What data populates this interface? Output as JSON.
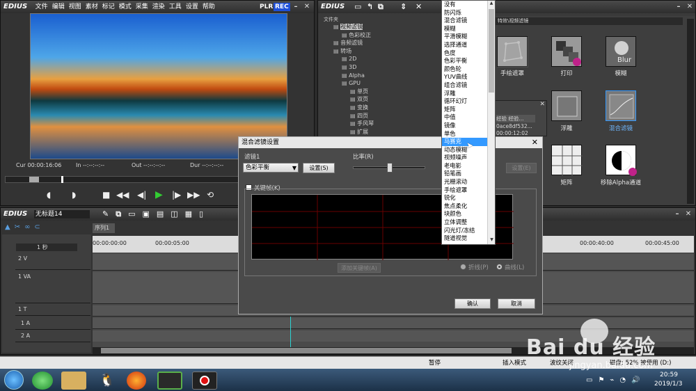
{
  "player": {
    "brand": "EDIUS",
    "menu": [
      "文件",
      "编辑",
      "视图",
      "素材",
      "标记",
      "模式",
      "采集",
      "渲染",
      "工具",
      "设置",
      "帮助"
    ],
    "plr": "PLR",
    "rec": "REC",
    "cur": "Cur 00:00:16:06",
    "in": "In --:--:--:--",
    "out": "Out --:--:--:--",
    "dur": "Dur --:--:--:--"
  },
  "library": {
    "brand": "EDIUS",
    "folder_header": "文件夹",
    "path": "特效\\视频滤镜",
    "tree": [
      {
        "label": "视频滤镜",
        "indent": 0
      },
      {
        "label": "色彩校正",
        "indent": 1
      },
      {
        "label": "音频滤镜",
        "indent": 0
      },
      {
        "label": "转场",
        "indent": 0
      },
      {
        "label": "2D",
        "indent": 1
      },
      {
        "label": "3D",
        "indent": 1
      },
      {
        "label": "Alpha",
        "indent": 1
      },
      {
        "label": "GPU",
        "indent": 1
      },
      {
        "label": "单页",
        "indent": 2
      },
      {
        "label": "双页",
        "indent": 2
      },
      {
        "label": "变换",
        "indent": 2
      },
      {
        "label": "四页",
        "indent": 2
      },
      {
        "label": "手风琴",
        "indent": 2
      },
      {
        "label": "扩展",
        "indent": 2
      }
    ],
    "effects": [
      {
        "label": "手绘遮罩"
      },
      {
        "label": "打印"
      },
      {
        "label": "模糊"
      },
      {
        "label": "浮雕"
      },
      {
        "label": "混合滤镜"
      },
      {
        "label": "矩阵"
      },
      {
        "label": "移除Alpha通道"
      }
    ],
    "blur_text": "Blur"
  },
  "info": {
    "line1": "经验 经验...",
    "line2": "0ace8df532...",
    "line3": "00:00:12:02"
  },
  "dropdown": {
    "items": [
      "没有",
      "防闪烁",
      "混合滤镜",
      "模糊",
      "平滑模糊",
      "选择通道",
      "色度",
      "色彩平衡",
      "颜色轮",
      "YUV曲线",
      "组合滤镜",
      "浮雕",
      "循环幻灯",
      "矩阵",
      "中值",
      "镜像",
      "单色",
      "马赛克",
      "动态模糊",
      "视频噪声",
      "老电影",
      "铅笔画",
      "光栅滚动",
      "手绘遮罩",
      "锐化",
      "焦点柔化",
      "块颜色",
      "立体调整",
      "闪光灯/冻结",
      "隧道视觉"
    ],
    "selected_index": 17
  },
  "dialog": {
    "title": "混合滤镜设置",
    "filter_label": "滤镜1",
    "filter_value": "色彩平衡",
    "settings_btn": "设置(S)",
    "ratio_label": "比率(R)",
    "ratio_value": 0.5,
    "settings_btn2": "设置(E)",
    "keyframe_label": "关键帧(K)",
    "add_keyframe": "添加关键帧(A)",
    "polyline": "折线(P)",
    "curve": "曲线(L)",
    "ok": "确认",
    "cancel": "取消"
  },
  "timeline": {
    "brand": "EDIUS",
    "project": "无标题14",
    "sequence_tab": "序列1",
    "scale": "1 秒",
    "ticks": [
      "00:00:00:00",
      "00:00:05:00",
      "00:00:40:00",
      "00:00:45:00"
    ],
    "tracks": [
      "2 V",
      "1 VA",
      "1 T",
      "1 A",
      "2 A"
    ]
  },
  "status": {
    "pause": "暂停",
    "insert_mode": "插入模式",
    "ripple_off": "波纹关闭",
    "disk": "磁盘: 52% 被使用 (D:)"
  },
  "taskbar": {
    "time": "20:59",
    "date": "2019/1/3"
  },
  "watermark": {
    "brand": "Bai du 经验",
    "url": "jingyan.baidu.com"
  },
  "colors": {
    "selection": "#3399ff",
    "rec": "#1e4fd8",
    "play_green": "#33cc33"
  }
}
